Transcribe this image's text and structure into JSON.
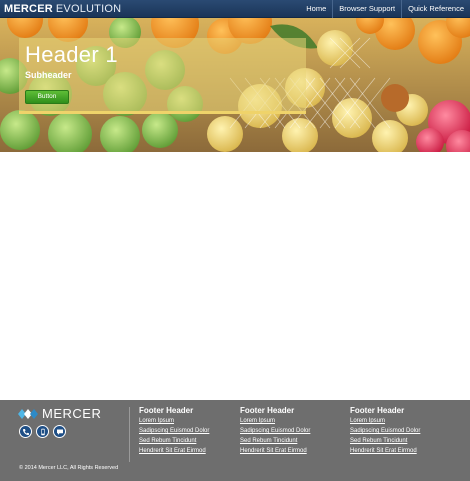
{
  "header": {
    "brand_bold": "MERCER",
    "brand_light": "EVOLUTION",
    "nav": [
      {
        "label": "Home"
      },
      {
        "label": "Browser Support"
      },
      {
        "label": "Quick Reference"
      }
    ]
  },
  "hero": {
    "title": "Header 1",
    "subtitle": "Subheader",
    "button_label": "Button"
  },
  "footer": {
    "logo_text": "MERCER",
    "social_icons": [
      "phone-icon",
      "mobile-icon",
      "chat-icon"
    ],
    "columns": [
      {
        "header": "Footer Header",
        "links": [
          "Lorem Ipsum",
          "Sadipscing Euismod Dolor",
          "Sed Rebum Tincidunt",
          "Hendrerit Sit Erat Eirmod"
        ]
      },
      {
        "header": "Footer Header",
        "links": [
          "Lorem Ipsum",
          "Sadipscing Euismod Dolor",
          "Sed Rebum Tincidunt",
          "Hendrerit Sit Erat Eirmod"
        ]
      },
      {
        "header": "Footer Header",
        "links": [
          "Lorem Ipsum",
          "Sadipscing Euismod Dolor",
          "Sed Rebum Tincidunt",
          "Hendrerit Sit Erat Eirmod"
        ]
      }
    ],
    "copyright": "© 2014 Mercer LLC, All Rights Reserved"
  },
  "colors": {
    "topbar": "#1f3b60",
    "button_green": "#3f9f24",
    "footer_bg": "#6e6e6e",
    "hero_panel_border": "#efd36a"
  }
}
